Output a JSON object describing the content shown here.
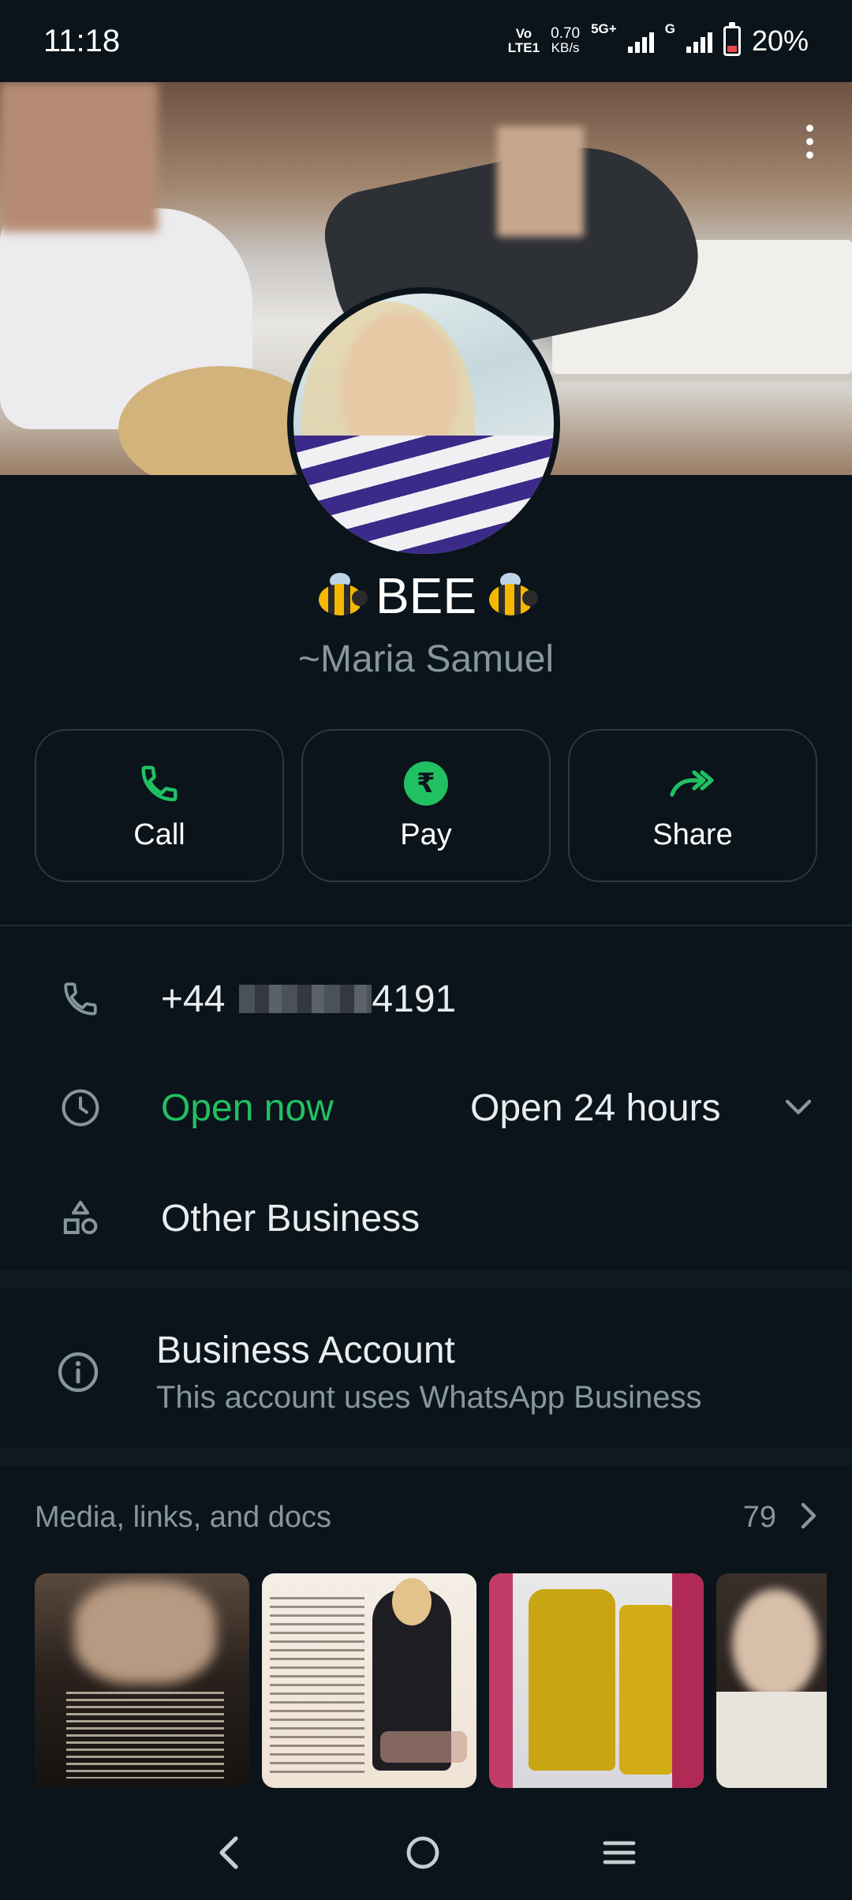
{
  "status": {
    "time": "11:18",
    "volte": "Vo",
    "lte": "LTE1",
    "speed_value": "0.70",
    "speed_unit": "KB/s",
    "net_5g": "5G+",
    "net_g": "G",
    "battery": "20%"
  },
  "profile": {
    "name": "BEE",
    "subname": "~Maria Samuel"
  },
  "actions": [
    {
      "label": "Call",
      "icon": "phone-icon"
    },
    {
      "label": "Pay",
      "icon": "rupee-icon"
    },
    {
      "label": "Share",
      "icon": "share-icon"
    }
  ],
  "info": {
    "phone_prefix": "+44",
    "phone_suffix": "4191",
    "open_now": "Open now",
    "hours": "Open 24 hours",
    "category": "Other Business"
  },
  "business": {
    "title": "Business Account",
    "subtitle": "This account uses WhatsApp Business"
  },
  "media": {
    "label": "Media, links, and docs",
    "count": "79"
  },
  "colors": {
    "background": "#0b141a",
    "accent_green": "#21c063",
    "secondary_text": "#8696a0"
  }
}
